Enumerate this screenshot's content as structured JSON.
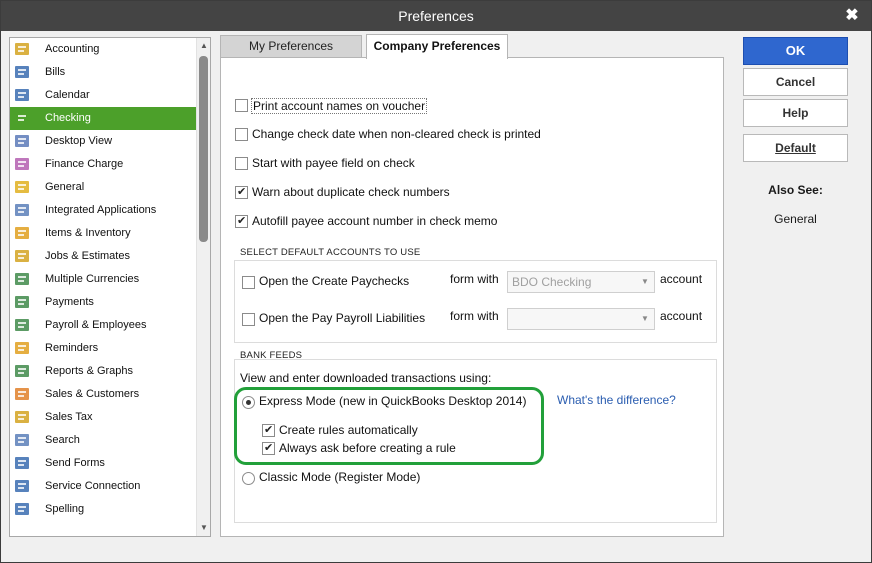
{
  "window": {
    "title": "Preferences",
    "close_label": "✖"
  },
  "sidebar": {
    "selected_index": 3,
    "items": [
      {
        "label": "Accounting",
        "icon": "accounting-icon"
      },
      {
        "label": "Bills",
        "icon": "bills-icon"
      },
      {
        "label": "Calendar",
        "icon": "calendar-icon"
      },
      {
        "label": "Checking",
        "icon": "checking-icon"
      },
      {
        "label": "Desktop View",
        "icon": "desktop-view-icon"
      },
      {
        "label": "Finance Charge",
        "icon": "finance-charge-icon"
      },
      {
        "label": "General",
        "icon": "general-icon"
      },
      {
        "label": "Integrated Applications",
        "icon": "integrated-applications-icon"
      },
      {
        "label": "Items & Inventory",
        "icon": "items-inventory-icon"
      },
      {
        "label": "Jobs & Estimates",
        "icon": "jobs-estimates-icon"
      },
      {
        "label": "Multiple Currencies",
        "icon": "multiple-currencies-icon"
      },
      {
        "label": "Payments",
        "icon": "payments-icon"
      },
      {
        "label": "Payroll & Employees",
        "icon": "payroll-employees-icon"
      },
      {
        "label": "Reminders",
        "icon": "reminders-icon"
      },
      {
        "label": "Reports & Graphs",
        "icon": "reports-graphs-icon"
      },
      {
        "label": "Sales & Customers",
        "icon": "sales-customers-icon"
      },
      {
        "label": "Sales Tax",
        "icon": "sales-tax-icon"
      },
      {
        "label": "Search",
        "icon": "search-icon"
      },
      {
        "label": "Send Forms",
        "icon": "send-forms-icon"
      },
      {
        "label": "Service Connection",
        "icon": "service-connection-icon"
      },
      {
        "label": "Spelling",
        "icon": "spelling-icon"
      }
    ]
  },
  "tabs": {
    "my_preferences": "My Preferences",
    "company_preferences": "Company Preferences",
    "active": "company_preferences"
  },
  "company": {
    "options": [
      {
        "label": "Print account names on voucher",
        "checked": false
      },
      {
        "label": "Change check date when non-cleared check is printed",
        "checked": false
      },
      {
        "label": "Start with payee field on check",
        "checked": false
      },
      {
        "label": "Warn about duplicate check numbers",
        "checked": true
      },
      {
        "label": "Autofill payee account number in check memo",
        "checked": true
      }
    ],
    "default_accounts": {
      "title": "SELECT DEFAULT ACCOUNTS TO USE",
      "rows": [
        {
          "label": "Open the Create Paychecks",
          "form_with": "form with",
          "value": "BDO Checking",
          "account": "account",
          "checked": false
        },
        {
          "label": "Open the Pay Payroll Liabilities",
          "form_with": "form with",
          "value": "",
          "account": "account",
          "checked": false
        }
      ]
    },
    "bank_feeds": {
      "title": "BANK FEEDS",
      "intro": "View and enter downloaded transactions using:",
      "express_mode": "Express Mode (new in QuickBooks Desktop 2014)",
      "express_selected": true,
      "create_rules": "Create rules automatically",
      "create_rules_checked": true,
      "always_ask": "Always ask before creating a rule",
      "always_ask_checked": true,
      "classic_mode": "Classic Mode (Register Mode)",
      "whats_difference": "What's the difference?"
    }
  },
  "buttons": {
    "ok": "OK",
    "cancel": "Cancel",
    "help": "Help",
    "default": "Default"
  },
  "also_see": {
    "title": "Also See:",
    "items": [
      "General"
    ]
  },
  "colors": {
    "accent": "#2f67cf",
    "selected": "#4ca02a",
    "highlight": "#22a03a",
    "link": "#2a5db0"
  }
}
